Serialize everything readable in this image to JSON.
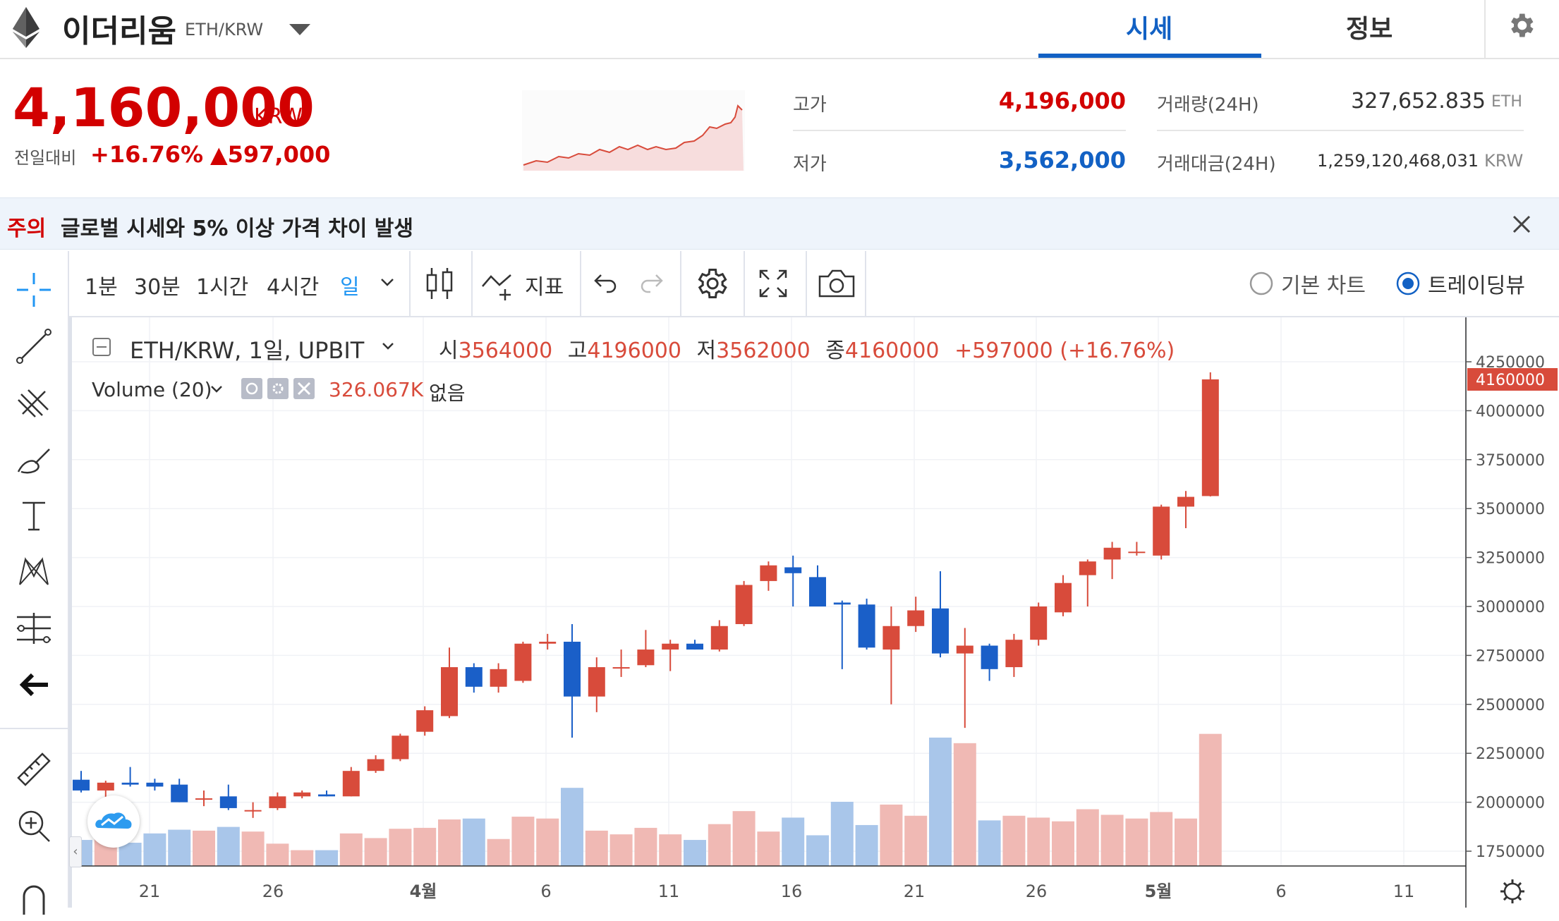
{
  "header": {
    "coin_name": "이더리움",
    "pair": "ETH/KRW",
    "tabs": [
      {
        "label": "시세"
      },
      {
        "label": "정보"
      }
    ],
    "icons": {
      "coin": "ethereum-icon",
      "dropdown": "caret-down-icon",
      "settings": "gear-icon"
    }
  },
  "price": {
    "value": "4,160,000",
    "unit": "KRW",
    "change_label": "전일대비",
    "change_pct": "+16.76%",
    "change_abs": "▲597,000"
  },
  "stats": {
    "high_label": "고가",
    "high_value": "4,196,000",
    "low_label": "저가",
    "low_value": "3,562,000",
    "volume_label": "거래량(24H)",
    "volume_value": "327,652.835",
    "volume_unit": "ETH",
    "amount_label": "거래대금(24H)",
    "amount_value": "1,259,120,468,031",
    "amount_unit": "KRW"
  },
  "notice": {
    "tag": "주의",
    "text": "글로벌 시세와 5% 이상 가격 차이 발생"
  },
  "toolbar": {
    "timeframes": [
      "1분",
      "30분",
      "1시간",
      "4시간",
      "일"
    ],
    "indicator_label": "지표",
    "radio_basic": "기본 차트",
    "radio_tradingview": "트레이딩뷰"
  },
  "legend": {
    "symbol": "ETH/KRW, 1일, UPBIT",
    "o_label": "시",
    "o_val": "3564000",
    "h_label": "고",
    "h_val": "4196000",
    "l_label": "저",
    "l_val": "3562000",
    "c_label": "종",
    "c_val": "4160000",
    "change": "+597000 (+16.76%)",
    "volume_label": "Volume (20)",
    "volume_val": "326.067K",
    "volume_extra": "없음"
  },
  "colors": {
    "up": "#d84b3b",
    "down": "#1a5fc8",
    "vol_up": "#f0b9b4",
    "vol_down": "#a9c6ea",
    "accent": "#1261c4"
  },
  "chart_data": {
    "type": "candlestick",
    "y_ticks": [
      1750000,
      2000000,
      2250000,
      2500000,
      2750000,
      3000000,
      3250000,
      3500000,
      3750000,
      4000000,
      4250000
    ],
    "ylim": [
      1650000,
      4300000
    ],
    "last_price_label": "4160000",
    "x_tick_labels": [
      "21",
      "26",
      "4월",
      "6",
      "11",
      "16",
      "21",
      "26",
      "5월",
      "6",
      "11"
    ],
    "candles": [
      {
        "o": 2115000,
        "h": 2160000,
        "l": 2050000,
        "c": 2060000,
        "v": 140
      },
      {
        "o": 2060000,
        "h": 2110000,
        "l": 2020000,
        "c": 2100000,
        "v": 150
      },
      {
        "o": 2100000,
        "h": 2180000,
        "l": 2080000,
        "c": 2090000,
        "v": 125
      },
      {
        "o": 2100000,
        "h": 2120000,
        "l": 2060000,
        "c": 2080000,
        "v": 175
      },
      {
        "o": 2090000,
        "h": 2120000,
        "l": 2000000,
        "c": 2000000,
        "v": 195
      },
      {
        "o": 2020000,
        "h": 2060000,
        "l": 1980000,
        "c": 2020000,
        "v": 190
      },
      {
        "o": 2030000,
        "h": 2090000,
        "l": 1960000,
        "c": 1970000,
        "v": 210
      },
      {
        "o": 1960000,
        "h": 2000000,
        "l": 1920000,
        "c": 1960000,
        "v": 185
      },
      {
        "o": 1970000,
        "h": 2050000,
        "l": 1960000,
        "c": 2030000,
        "v": 120
      },
      {
        "o": 2030000,
        "h": 2060000,
        "l": 2020000,
        "c": 2050000,
        "v": 85
      },
      {
        "o": 2040000,
        "h": 2060000,
        "l": 2030000,
        "c": 2030000,
        "v": 85
      },
      {
        "o": 2030000,
        "h": 2180000,
        "l": 2030000,
        "c": 2160000,
        "v": 175
      },
      {
        "o": 2160000,
        "h": 2240000,
        "l": 2150000,
        "c": 2220000,
        "v": 150
      },
      {
        "o": 2220000,
        "h": 2350000,
        "l": 2210000,
        "c": 2340000,
        "v": 200
      },
      {
        "o": 2360000,
        "h": 2490000,
        "l": 2340000,
        "c": 2470000,
        "v": 205
      },
      {
        "o": 2440000,
        "h": 2790000,
        "l": 2430000,
        "c": 2690000,
        "v": 250
      },
      {
        "o": 2690000,
        "h": 2710000,
        "l": 2560000,
        "c": 2590000,
        "v": 255
      },
      {
        "o": 2590000,
        "h": 2710000,
        "l": 2560000,
        "c": 2680000,
        "v": 145
      },
      {
        "o": 2620000,
        "h": 2820000,
        "l": 2610000,
        "c": 2810000,
        "v": 265
      },
      {
        "o": 2810000,
        "h": 2860000,
        "l": 2780000,
        "c": 2820000,
        "v": 255
      },
      {
        "o": 2820000,
        "h": 2910000,
        "l": 2330000,
        "c": 2540000,
        "v": 420
      },
      {
        "o": 2540000,
        "h": 2740000,
        "l": 2460000,
        "c": 2690000,
        "v": 190
      },
      {
        "o": 2690000,
        "h": 2780000,
        "l": 2640000,
        "c": 2690000,
        "v": 170
      },
      {
        "o": 2700000,
        "h": 2880000,
        "l": 2690000,
        "c": 2780000,
        "v": 205
      },
      {
        "o": 2780000,
        "h": 2830000,
        "l": 2670000,
        "c": 2810000,
        "v": 170
      },
      {
        "o": 2810000,
        "h": 2830000,
        "l": 2780000,
        "c": 2780000,
        "v": 140
      },
      {
        "o": 2780000,
        "h": 2930000,
        "l": 2770000,
        "c": 2900000,
        "v": 225
      },
      {
        "o": 2910000,
        "h": 3130000,
        "l": 2900000,
        "c": 3110000,
        "v": 295
      },
      {
        "o": 3130000,
        "h": 3230000,
        "l": 3080000,
        "c": 3210000,
        "v": 185
      },
      {
        "o": 3200000,
        "h": 3260000,
        "l": 3000000,
        "c": 3170000,
        "v": 260
      },
      {
        "o": 3150000,
        "h": 3210000,
        "l": 3000000,
        "c": 3000000,
        "v": 165
      },
      {
        "o": 3020000,
        "h": 3030000,
        "l": 2680000,
        "c": 3010000,
        "v": 345
      },
      {
        "o": 3010000,
        "h": 3040000,
        "l": 2780000,
        "c": 2790000,
        "v": 220
      },
      {
        "o": 2780000,
        "h": 3000000,
        "l": 2500000,
        "c": 2900000,
        "v": 330
      },
      {
        "o": 2900000,
        "h": 3050000,
        "l": 2870000,
        "c": 2980000,
        "v": 270
      },
      {
        "o": 2990000,
        "h": 3180000,
        "l": 2740000,
        "c": 2760000,
        "v": 690
      },
      {
        "o": 2760000,
        "h": 2890000,
        "l": 2380000,
        "c": 2800000,
        "v": 660
      },
      {
        "o": 2800000,
        "h": 2810000,
        "l": 2620000,
        "c": 2680000,
        "v": 245
      },
      {
        "o": 2690000,
        "h": 2860000,
        "l": 2640000,
        "c": 2830000,
        "v": 270
      },
      {
        "o": 2830000,
        "h": 3020000,
        "l": 2800000,
        "c": 3000000,
        "v": 260
      },
      {
        "o": 2970000,
        "h": 3160000,
        "l": 2950000,
        "c": 3120000,
        "v": 240
      },
      {
        "o": 3160000,
        "h": 3240000,
        "l": 3000000,
        "c": 3230000,
        "v": 305
      },
      {
        "o": 3240000,
        "h": 3330000,
        "l": 3140000,
        "c": 3300000,
        "v": 275
      },
      {
        "o": 3280000,
        "h": 3330000,
        "l": 3260000,
        "c": 3280000,
        "v": 255
      },
      {
        "o": 3260000,
        "h": 3520000,
        "l": 3240000,
        "c": 3510000,
        "v": 290
      },
      {
        "o": 3510000,
        "h": 3590000,
        "l": 3400000,
        "c": 3560000,
        "v": 255
      },
      {
        "o": 3564000,
        "h": 4196000,
        "l": 3562000,
        "c": 4160000,
        "v": 710
      }
    ]
  }
}
